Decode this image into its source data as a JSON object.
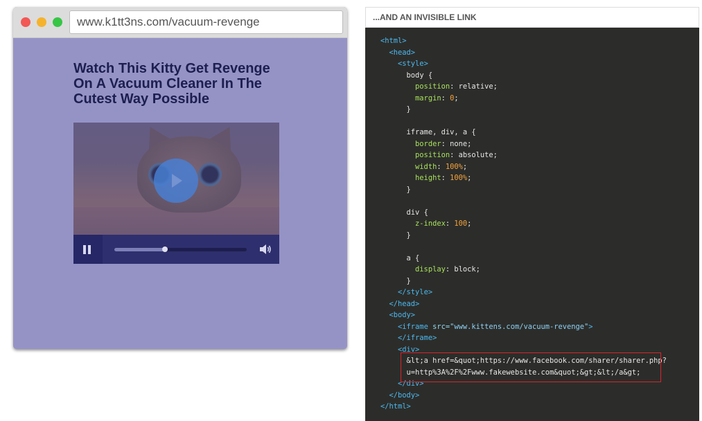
{
  "browser": {
    "url": "www.k1tt3ns.com/vacuum-revenge",
    "headline": "Watch This Kitty Get Revenge On A Vacuum Cleaner In The Cutest Way Possible",
    "video": {
      "progress": 0.38,
      "play_icon": "play-icon",
      "pause_icon": "pause-icon",
      "volume_icon": "volume-icon"
    },
    "colors": {
      "page_overlay": "#9593c6",
      "headline": "#1d1f50",
      "controls": "#2e2f6e",
      "play_button": "#4880d6"
    }
  },
  "code_panel": {
    "title": "...AND AN INVISIBLE LINK",
    "lines": [
      {
        "indent": 0,
        "parts": [
          {
            "t": "tag",
            "s": "<html>"
          }
        ]
      },
      {
        "indent": 1,
        "parts": [
          {
            "t": "tag",
            "s": "<head>"
          }
        ]
      },
      {
        "indent": 2,
        "parts": [
          {
            "t": "tag",
            "s": "<style>"
          }
        ]
      },
      {
        "indent": 3,
        "parts": [
          {
            "t": "plain",
            "s": "body {"
          }
        ]
      },
      {
        "indent": 4,
        "parts": [
          {
            "t": "prop",
            "s": "position"
          },
          {
            "t": "plain",
            "s": ": relative;"
          }
        ]
      },
      {
        "indent": 4,
        "parts": [
          {
            "t": "prop",
            "s": "margin"
          },
          {
            "t": "plain",
            "s": ": "
          },
          {
            "t": "num",
            "s": "0"
          },
          {
            "t": "plain",
            "s": ";"
          }
        ]
      },
      {
        "indent": 3,
        "parts": [
          {
            "t": "plain",
            "s": "}"
          }
        ]
      },
      {
        "indent": 0,
        "parts": []
      },
      {
        "indent": 3,
        "parts": [
          {
            "t": "plain",
            "s": "iframe, div, a {"
          }
        ]
      },
      {
        "indent": 4,
        "parts": [
          {
            "t": "prop",
            "s": "border"
          },
          {
            "t": "plain",
            "s": ": none;"
          }
        ]
      },
      {
        "indent": 4,
        "parts": [
          {
            "t": "prop",
            "s": "position"
          },
          {
            "t": "plain",
            "s": ": absolute;"
          }
        ]
      },
      {
        "indent": 4,
        "parts": [
          {
            "t": "prop",
            "s": "width"
          },
          {
            "t": "plain",
            "s": ": "
          },
          {
            "t": "num",
            "s": "100%"
          },
          {
            "t": "plain",
            "s": ";"
          }
        ]
      },
      {
        "indent": 4,
        "parts": [
          {
            "t": "prop",
            "s": "height"
          },
          {
            "t": "plain",
            "s": ": "
          },
          {
            "t": "num",
            "s": "100%"
          },
          {
            "t": "plain",
            "s": ";"
          }
        ]
      },
      {
        "indent": 3,
        "parts": [
          {
            "t": "plain",
            "s": "}"
          }
        ]
      },
      {
        "indent": 0,
        "parts": []
      },
      {
        "indent": 3,
        "parts": [
          {
            "t": "plain",
            "s": "div {"
          }
        ]
      },
      {
        "indent": 4,
        "parts": [
          {
            "t": "prop",
            "s": "z-index"
          },
          {
            "t": "plain",
            "s": ": "
          },
          {
            "t": "num",
            "s": "100"
          },
          {
            "t": "plain",
            "s": ";"
          }
        ]
      },
      {
        "indent": 3,
        "parts": [
          {
            "t": "plain",
            "s": "}"
          }
        ]
      },
      {
        "indent": 0,
        "parts": []
      },
      {
        "indent": 3,
        "parts": [
          {
            "t": "plain",
            "s": "a {"
          }
        ]
      },
      {
        "indent": 4,
        "parts": [
          {
            "t": "prop",
            "s": "display"
          },
          {
            "t": "plain",
            "s": ": block;"
          }
        ]
      },
      {
        "indent": 3,
        "parts": [
          {
            "t": "plain",
            "s": "}"
          }
        ]
      },
      {
        "indent": 2,
        "parts": [
          {
            "t": "tag",
            "s": "</style>"
          }
        ]
      },
      {
        "indent": 1,
        "parts": [
          {
            "t": "tag",
            "s": "</head>"
          }
        ]
      },
      {
        "indent": 1,
        "parts": [
          {
            "t": "tag",
            "s": "<body>"
          }
        ]
      },
      {
        "indent": 2,
        "parts": [
          {
            "t": "tag",
            "s": "<iframe "
          },
          {
            "t": "attr",
            "s": "src="
          },
          {
            "t": "str",
            "s": "\"www.kittens.com/vacuum-revenge\""
          },
          {
            "t": "tag",
            "s": ">"
          }
        ]
      },
      {
        "indent": 2,
        "parts": [
          {
            "t": "tag",
            "s": "</iframe>"
          }
        ]
      },
      {
        "indent": 2,
        "parts": [
          {
            "t": "tag",
            "s": "<div>"
          }
        ]
      },
      {
        "indent": 3,
        "parts": [
          {
            "t": "plain",
            "s": "&lt;a href=&quot;https://www.facebook.com/sharer/sharer.php?"
          }
        ]
      },
      {
        "indent": 3,
        "parts": [
          {
            "t": "plain",
            "s": "u=http%3A%2F%2Fwww.fakewebsite.com&quot;&gt;&lt;/a&gt;"
          }
        ]
      },
      {
        "indent": 2,
        "parts": [
          {
            "t": "tag",
            "s": "</div>"
          }
        ]
      },
      {
        "indent": 1,
        "parts": [
          {
            "t": "tag",
            "s": "</body>"
          }
        ]
      },
      {
        "indent": 0,
        "parts": [
          {
            "t": "tag",
            "s": "</html>"
          }
        ]
      }
    ],
    "colors": {
      "background": "#2c2d2a",
      "tag": "#4db8f0",
      "property": "#a8e05c",
      "number": "#f5a23c",
      "highlight_border": "#d8242e"
    }
  }
}
